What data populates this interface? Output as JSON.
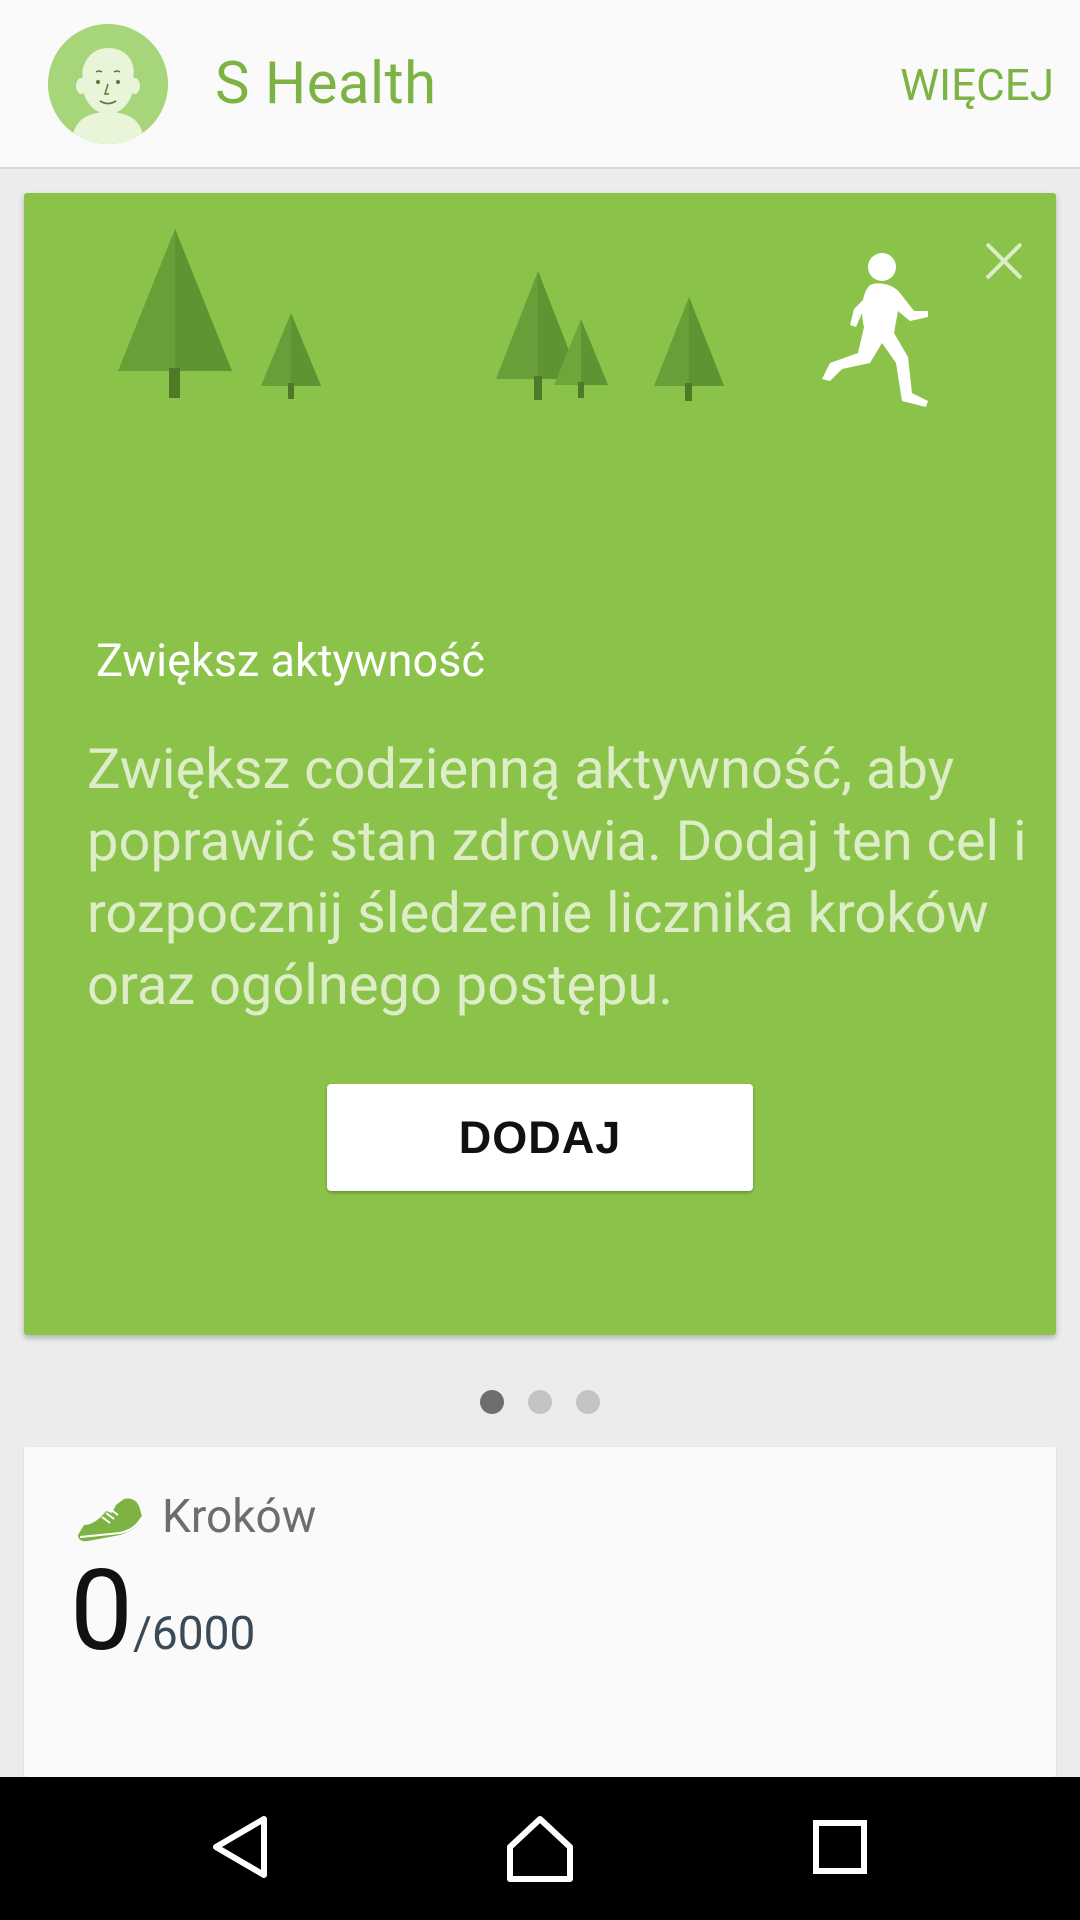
{
  "header": {
    "app_title": "S Health",
    "more_label": "WIĘCEJ",
    "avatar_icon": "profile-face-icon"
  },
  "promo": {
    "title": "Zwiększ aktywność",
    "body": "Zwiększ codzienną aktywność, aby poprawić stan zdrowia. Dodaj ten cel i rozpocznij śledzenie licznika kroków oraz ogólnego postępu.",
    "add_button_label": "DODAJ",
    "close_icon": "close-icon",
    "runner_icon": "runner-icon",
    "background_color": "#8bc34a",
    "tree_colors": [
      "#689f38",
      "#4e7a27"
    ]
  },
  "pager": {
    "count": 3,
    "active_index": 0
  },
  "steps": {
    "label": "Kroków",
    "current": "0",
    "goal": "/6000",
    "icon": "shoe-icon",
    "accent_color": "#7cb342"
  },
  "navbar": {
    "back_icon": "back-triangle-icon",
    "home_icon": "home-icon",
    "recents_icon": "recents-square-icon"
  }
}
